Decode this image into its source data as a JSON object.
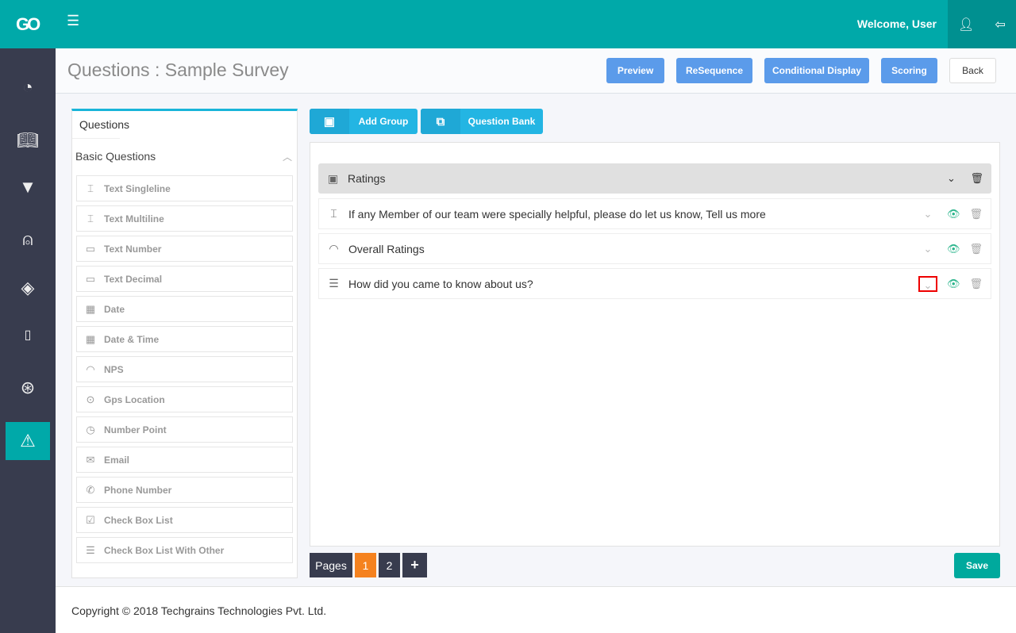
{
  "header": {
    "logo": "GO",
    "welcome": "Welcome, User"
  },
  "sidebar": {
    "items": [
      {
        "icon": "dashboard-icon"
      },
      {
        "icon": "book-icon"
      },
      {
        "icon": "filter-icon"
      },
      {
        "icon": "user-icon"
      },
      {
        "icon": "layers-icon"
      },
      {
        "icon": "tablet-icon"
      },
      {
        "icon": "lifebuoy-icon"
      },
      {
        "icon": "warning-icon",
        "active": true
      }
    ]
  },
  "page": {
    "title": "Questions : Sample Survey"
  },
  "toolbar": {
    "preview": "Preview",
    "resequence": "ReSequence",
    "conditional": "Conditional Display",
    "scoring": "Scoring",
    "back": "Back"
  },
  "left": {
    "tab": "Questions",
    "section": "Basic Questions",
    "items": [
      "Text Singleline",
      "Text Multiline",
      "Text Number",
      "Text Decimal",
      "Date",
      "Date & Time",
      "NPS",
      "Gps Location",
      "Number Point",
      "Email",
      "Phone Number",
      "Check Box List",
      "Check Box List With Other"
    ]
  },
  "actions": {
    "add_group": "Add Group",
    "question_bank": "Question Bank"
  },
  "group": {
    "name": "Ratings",
    "questions": [
      "If any Member of our team were specially helpful, please do let us know, Tell us more",
      "Overall Ratings",
      "How did you came to know about us?"
    ]
  },
  "pagination": {
    "label": "Pages",
    "pages": [
      "1",
      "2"
    ],
    "current": "1",
    "add": "+"
  },
  "save": "Save",
  "footer": "Copyright © 2018 Techgrains Technologies Pvt. Ltd.",
  "colors": {
    "primary": "#00a9a9",
    "sidebar": "#383c4e",
    "button": "#5b9bea",
    "active_page": "#f5821f"
  }
}
